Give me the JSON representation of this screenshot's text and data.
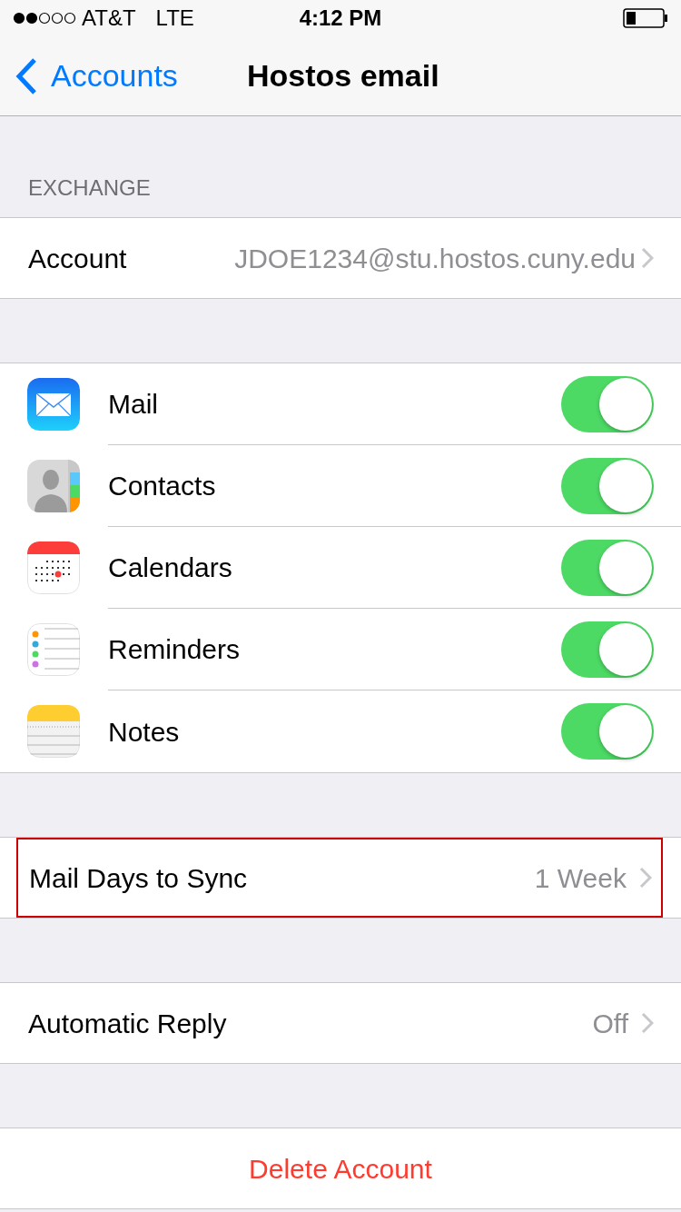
{
  "status_bar": {
    "carrier": "AT&T",
    "network": "LTE",
    "time": "4:12 PM"
  },
  "nav": {
    "back": "Accounts",
    "title": "Hostos email"
  },
  "section_header": "EXCHANGE",
  "account": {
    "label": "Account",
    "value": "JDOE1234@stu.hostos.cuny.edu"
  },
  "services": [
    {
      "kind": "mail",
      "label": "Mail",
      "on": true
    },
    {
      "kind": "contacts",
      "label": "Contacts",
      "on": true
    },
    {
      "kind": "calendars",
      "label": "Calendars",
      "on": true
    },
    {
      "kind": "reminders",
      "label": "Reminders",
      "on": true
    },
    {
      "kind": "notes",
      "label": "Notes",
      "on": true
    }
  ],
  "sync": {
    "label": "Mail Days to Sync",
    "value": "1 Week",
    "highlighted": true
  },
  "auto_reply": {
    "label": "Automatic Reply",
    "value": "Off"
  },
  "delete_button": "Delete Account"
}
